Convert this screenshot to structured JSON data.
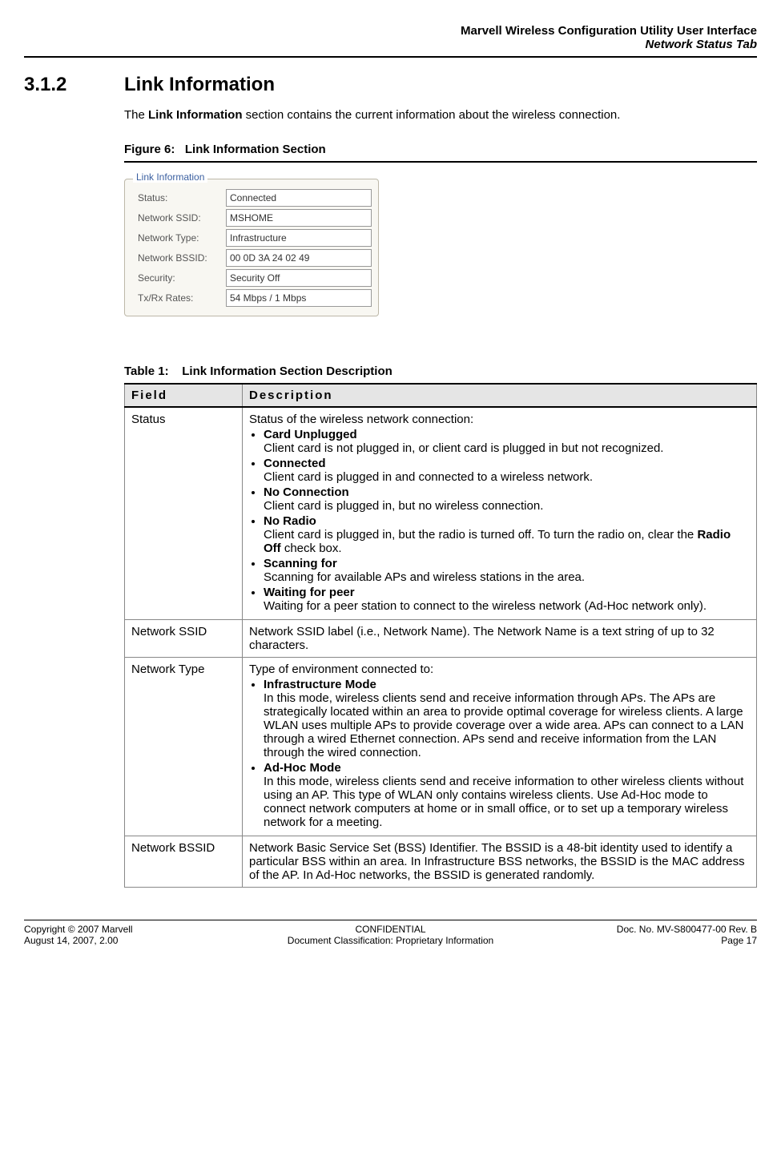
{
  "header": {
    "line1": "Marvell Wireless Configuration Utility User Interface",
    "line2": "Network Status Tab"
  },
  "section": {
    "number": "3.1.2",
    "title": "Link Information",
    "intro_pre": "The ",
    "intro_bold": "Link Information",
    "intro_post": " section contains the current information about the wireless connection."
  },
  "figure": {
    "label": "Figure 6:",
    "title": "Link Information Section"
  },
  "link_info": {
    "legend": "Link Information",
    "rows": [
      {
        "label": "Status:",
        "value": "Connected"
      },
      {
        "label": "Network SSID:",
        "value": "MSHOME"
      },
      {
        "label": "Network Type:",
        "value": "Infrastructure"
      },
      {
        "label": "Network BSSID:",
        "value": "00 0D 3A 24 02 49"
      },
      {
        "label": "Security:",
        "value": "Security Off"
      },
      {
        "label": "Tx/Rx Rates:",
        "value": "54 Mbps / 1 Mbps"
      }
    ]
  },
  "table": {
    "label": "Table 1:",
    "title": "Link Information Section Description",
    "col_field": "Field",
    "col_desc": "Description",
    "rows": {
      "status": {
        "field": "Status",
        "lead": "Status of the wireless network connection:",
        "items": [
          {
            "term": "Card Unplugged",
            "desc": "Client card is not plugged in, or client card is plugged in but not recognized."
          },
          {
            "term": "Connected",
            "desc": "Client card is plugged in and connected to a wireless network."
          },
          {
            "term": "No Connection",
            "desc": "Client card is plugged in, but no wireless connection."
          },
          {
            "term": "No Radio",
            "desc_pre": "Client card is plugged in, but the radio is turned off. To turn the radio on, clear the ",
            "desc_bold": "Radio Off",
            "desc_post": " check box."
          },
          {
            "term": "Scanning for",
            "desc": "Scanning for available APs and wireless stations in the area."
          },
          {
            "term": "Waiting for peer",
            "desc": "Waiting for a peer station to connect to the wireless network (Ad-Hoc network only)."
          }
        ]
      },
      "ssid": {
        "field": "Network SSID",
        "desc": "Network SSID label (i.e., Network Name). The Network Name is a text string of up to 32 characters."
      },
      "type": {
        "field": "Network Type",
        "lead": "Type of environment connected to:",
        "items": [
          {
            "term": "Infrastructure Mode",
            "desc": "In this mode, wireless clients send and receive information through APs. The APs are strategically located within an area to provide optimal coverage for wireless clients. A large WLAN uses multiple APs to provide coverage over a wide area. APs can connect to a LAN through a wired Ethernet connection. APs send and receive information from the LAN through the wired connection."
          },
          {
            "term": "Ad-Hoc Mode",
            "desc": "In this mode, wireless clients send and receive information to other wireless clients without using an AP. This type of WLAN only contains wireless clients. Use Ad-Hoc mode to connect network computers at home or in small office, or to set up a temporary wireless network for a meeting."
          }
        ]
      },
      "bssid": {
        "field": "Network BSSID",
        "desc": "Network Basic Service Set (BSS) Identifier. The BSSID is a 48-bit identity used to identify a particular BSS within an area. In Infrastructure BSS networks, the BSSID is the MAC address of the AP. In Ad-Hoc networks, the BSSID is generated randomly."
      }
    }
  },
  "footer": {
    "left1": "Copyright © 2007 Marvell",
    "left2": "August 14, 2007, 2.00",
    "center1": "CONFIDENTIAL",
    "center2": "Document Classification: Proprietary Information",
    "right1": "Doc. No. MV-S800477-00 Rev. B",
    "right2": "Page 17"
  }
}
